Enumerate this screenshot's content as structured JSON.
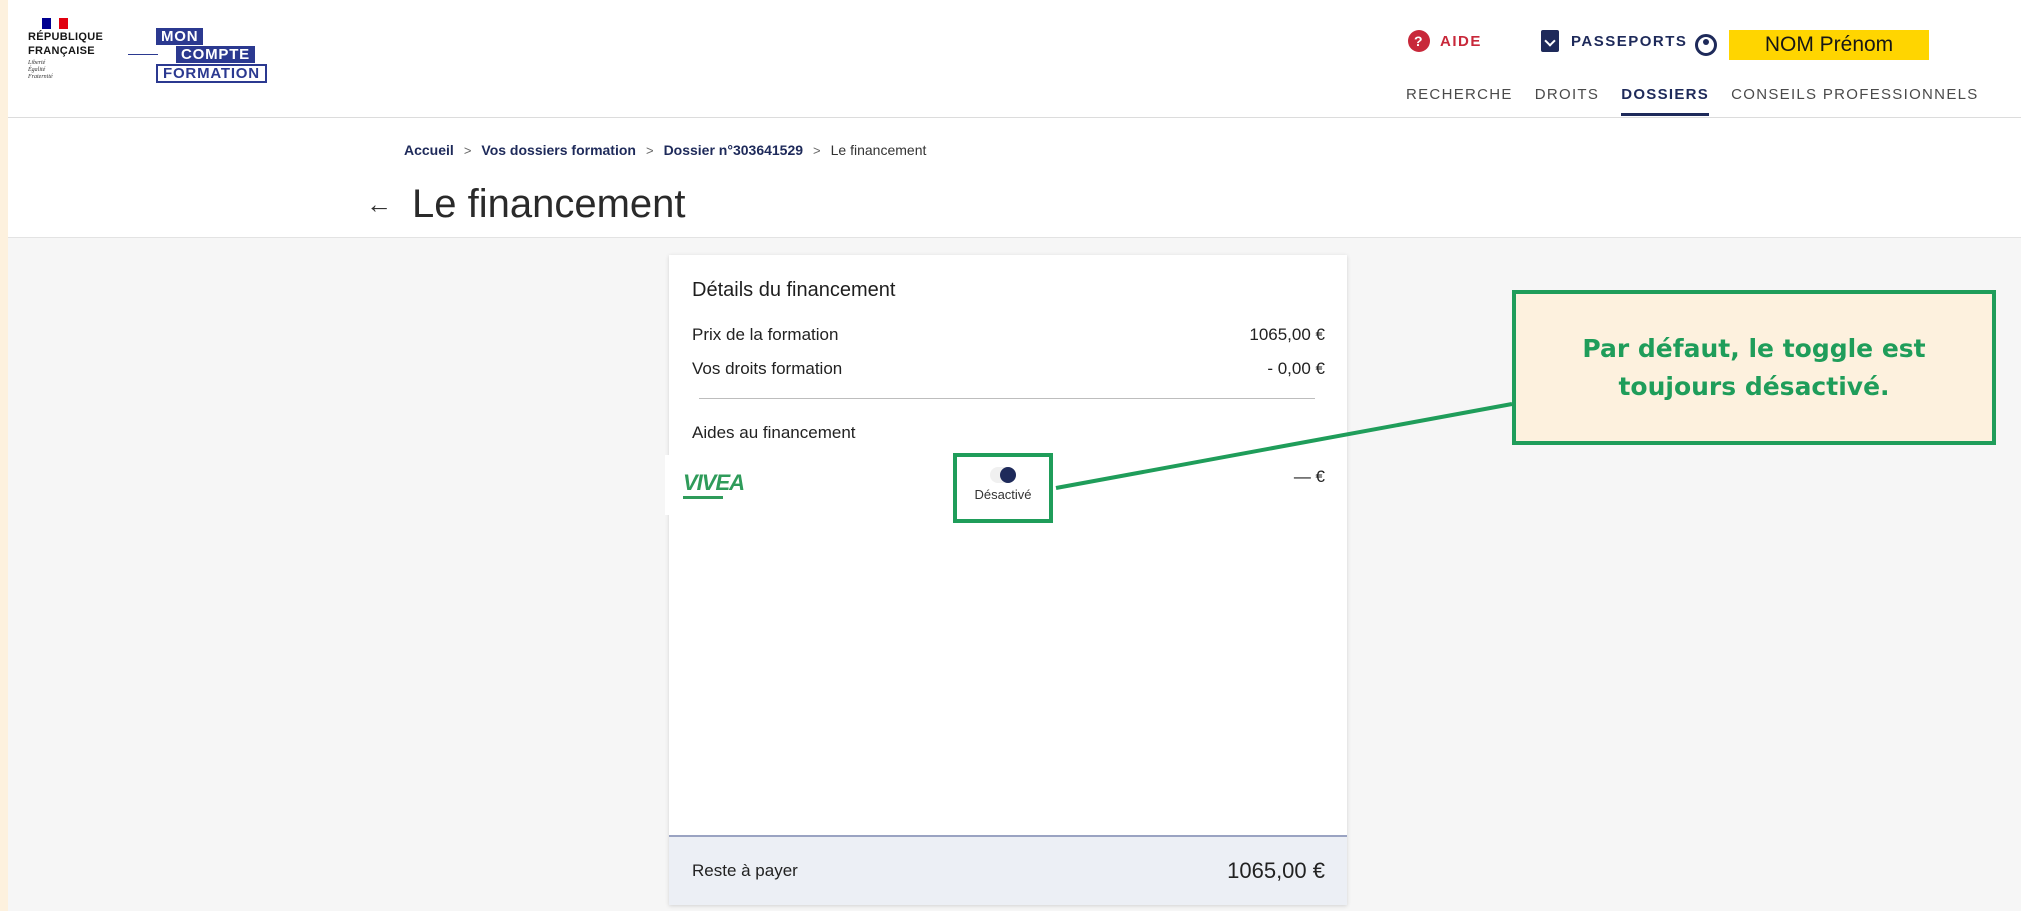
{
  "header": {
    "rf_logo": {
      "line1": "RÉPUBLIQUE",
      "line2": "FRANÇAISE",
      "motto": [
        "Liberté",
        "Égalité",
        "Fraternité"
      ]
    },
    "mcf_logo": {
      "mon": "MON",
      "compte": "COMPTE",
      "formation": "FORMATION"
    },
    "aide_label": "AIDE",
    "passeports_label": "PASSEPORTS",
    "user_name": "NOM Prénom",
    "nav": [
      "RECHERCHE",
      "DROITS",
      "DOSSIERS",
      "CONSEILS PROFESSIONNELS"
    ],
    "active_nav": "DOSSIERS"
  },
  "breadcrumb": [
    "Accueil",
    "Vos dossiers formation",
    "Dossier n°303641529",
    "Le financement"
  ],
  "page_title": "Le financement",
  "card": {
    "title": "Détails du financement",
    "price_label": "Prix de la formation",
    "price_value": "1065,00 €",
    "rights_label": "Vos droits formation",
    "rights_value": "- 0,00 €",
    "aides_label": "Aides au financement",
    "aid_provider": "VIVEA",
    "toggle_label": "Désactivé",
    "toggle_state": "off",
    "aid_amount": "— €",
    "footer_label": "Reste à payer",
    "footer_value": "1065,00 €"
  },
  "annotation": {
    "text": "Par défaut, le toggle est toujours désactivé."
  },
  "colors": {
    "accent_blue": "#1e2a5a",
    "aide_red": "#c8283a",
    "user_highlight": "#ffd500",
    "annotation_green": "#1f9d5a",
    "annotation_bg": "#fdf1de"
  }
}
